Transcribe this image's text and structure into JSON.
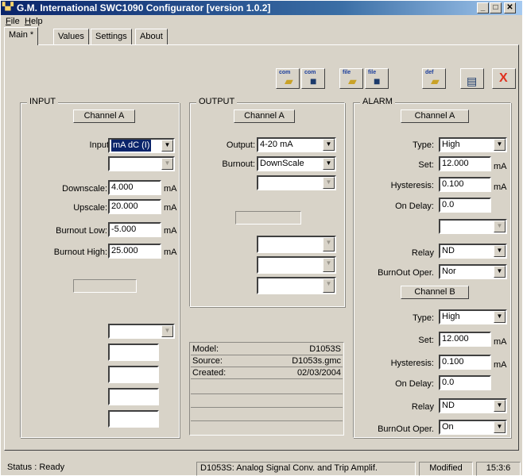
{
  "window": {
    "title": "G.M. International SWC1090 Configurator [version 1.0.2]",
    "icon": "gmi-app-icon",
    "controls": [
      "minimize",
      "maximize",
      "close"
    ]
  },
  "menu": [
    {
      "label": "File",
      "accel": "F",
      "rest": "ile"
    },
    {
      "label": "Help",
      "accel": "H",
      "rest": "elp"
    }
  ],
  "tabs": [
    {
      "label": "Main *",
      "active": true
    },
    {
      "label": "Values",
      "active": false
    },
    {
      "label": "Settings",
      "active": false
    },
    {
      "label": "About",
      "active": false
    }
  ],
  "toolbar": [
    {
      "name": "com-open-button",
      "label": "com",
      "icon": "folder-open-icon"
    },
    {
      "name": "com-save-button",
      "label": "com",
      "icon": "floppy-save-icon"
    },
    {
      "name": "file-open-button",
      "label": "file",
      "icon": "folder-open-icon"
    },
    {
      "name": "file-save-button",
      "label": "file",
      "icon": "floppy-save-icon"
    },
    {
      "name": "default-open-button",
      "label": "def",
      "icon": "folder-open-icon"
    },
    {
      "name": "print-button",
      "label": "",
      "icon": "printer-icon"
    },
    {
      "name": "exit-button",
      "label": "",
      "icon": "red-x-icon"
    }
  ],
  "input": {
    "title": "INPUT",
    "channel": "Channel A",
    "input_label": "Input",
    "input_value": "mA dC (I)",
    "downscale_label": "Downscale:",
    "downscale_value": "4.000",
    "upscale_label": "Upscale:",
    "upscale_value": "20.000",
    "burnout_low_label": "Burnout Low:",
    "burnout_low_value": "-5.000",
    "burnout_high_label": "Burnout High:",
    "burnout_high_value": "25.000",
    "unit": "mA"
  },
  "output": {
    "title": "OUTPUT",
    "channel": "Channel A",
    "output_label": "Output:",
    "output_value": "4-20 mA",
    "burnout_label": "Burnout:",
    "burnout_value": "DownScale"
  },
  "info": {
    "model_label": "Model:",
    "model_value": "D1053S",
    "source_label": "Source:",
    "source_value": "D1053s.gmc",
    "created_label": "Created:",
    "created_value": "02/03/2004"
  },
  "alarm": {
    "title": "ALARM",
    "channel_a": {
      "label": "Channel A",
      "type_label": "Type:",
      "type_value": "High",
      "set_label": "Set:",
      "set_value": "12.000",
      "hysteresis_label": "Hysteresis:",
      "hysteresis_value": "0.100",
      "on_delay_label": "On Delay:",
      "on_delay_value": "0.0",
      "relay_label": "Relay",
      "relay_value": "ND",
      "burnout_label": "BurnOut Oper.",
      "burnout_value": "Nor"
    },
    "channel_b": {
      "label": "Channel B",
      "type_label": "Type:",
      "type_value": "High",
      "set_label": "Set:",
      "set_value": "12.000",
      "hysteresis_label": "Hysteresis:",
      "hysteresis_value": "0.100",
      "on_delay_label": "On Delay:",
      "on_delay_value": "0.0",
      "relay_label": "Relay",
      "relay_value": "ND",
      "burnout_label": "BurnOut Oper.",
      "burnout_value": "On"
    },
    "unit": "mA"
  },
  "status": {
    "state": "Status : Ready",
    "device": "D1053S: Analog Signal Conv. and Trip Amplif.",
    "modified": "Modified",
    "time": "15:3:6"
  },
  "colors": {
    "title_gradient_start": "#0a246a",
    "title_gradient_end": "#a6caf0",
    "window_face": "#d8d3c8",
    "selection": "#0a246a"
  }
}
